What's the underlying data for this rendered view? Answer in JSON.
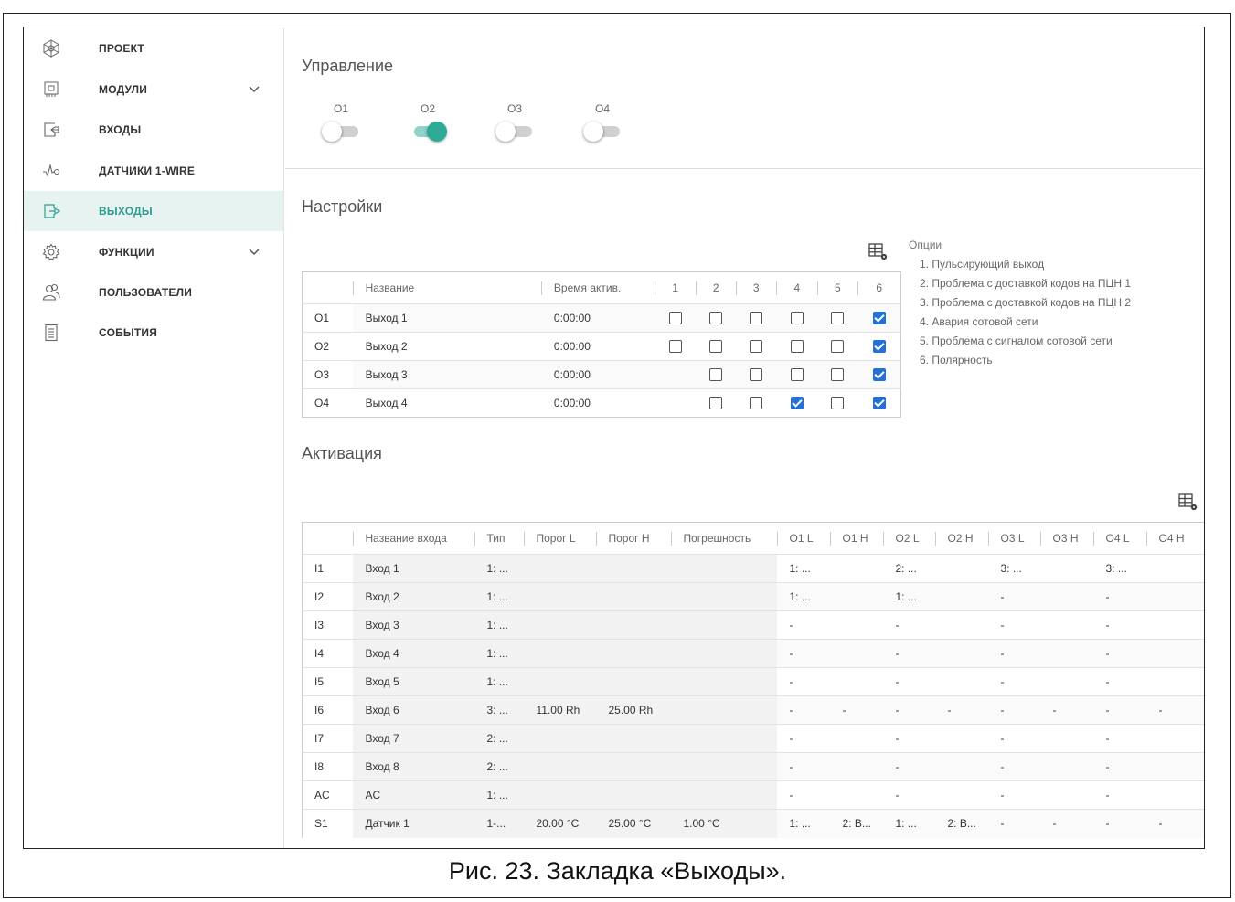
{
  "sidebar": {
    "items": [
      {
        "label": "ПРОЕКТ",
        "icon": "project-icon",
        "chevron": false,
        "active": false
      },
      {
        "label": "МОДУЛИ",
        "icon": "module-chip-icon",
        "chevron": true,
        "active": false
      },
      {
        "label": "ВХОДЫ",
        "icon": "input-arrow-icon",
        "chevron": false,
        "active": false
      },
      {
        "label": "ДАТЧИКИ 1-WIRE",
        "icon": "sensor-wave-icon",
        "chevron": false,
        "active": false
      },
      {
        "label": "ВЫХОДЫ",
        "icon": "output-arrow-icon",
        "chevron": false,
        "active": true
      },
      {
        "label": "ФУНКЦИИ",
        "icon": "gear-icon",
        "chevron": true,
        "active": false
      },
      {
        "label": "ПОЛЬЗОВАТЕЛИ",
        "icon": "users-icon",
        "chevron": false,
        "active": false
      },
      {
        "label": "СОБЫТИЯ",
        "icon": "events-list-icon",
        "chevron": false,
        "active": false
      }
    ]
  },
  "control": {
    "title": "Управление",
    "switches": [
      {
        "label": "O1",
        "on": false
      },
      {
        "label": "O2",
        "on": true
      },
      {
        "label": "O3",
        "on": false
      },
      {
        "label": "O4",
        "on": false
      }
    ]
  },
  "settings": {
    "title": "Настройки",
    "columns": [
      "Название",
      "Время актив.",
      "1",
      "2",
      "3",
      "4",
      "5",
      "6"
    ],
    "rows": [
      {
        "id": "O1",
        "name": "Выход 1",
        "time": "0:00:00",
        "opts": [
          false,
          false,
          false,
          false,
          false,
          true
        ]
      },
      {
        "id": "O2",
        "name": "Выход 2",
        "time": "0:00:00",
        "opts": [
          false,
          false,
          false,
          false,
          false,
          true
        ]
      },
      {
        "id": "O3",
        "name": "Выход 3",
        "time": "0:00:00",
        "opts": [
          null,
          false,
          false,
          false,
          false,
          true
        ]
      },
      {
        "id": "O4",
        "name": "Выход 4",
        "time": "0:00:00",
        "opts": [
          null,
          false,
          false,
          true,
          false,
          true
        ]
      }
    ],
    "options_title": "Опции",
    "options": [
      "1. Пульсирующий выход",
      "2. Проблема с доставкой кодов на ПЦН 1",
      "3. Проблема с доставкой кодов на ПЦН 2",
      "4. Авария сотовой сети",
      "5. Проблема с сигналом сотовой сети",
      "6. Полярность"
    ]
  },
  "activation": {
    "title": "Активация",
    "columns": [
      "Название входа",
      "Тип",
      "Порог L",
      "Порог H",
      "Погрешность",
      "O1 L",
      "O1 H",
      "O2 L",
      "O2 H",
      "O3 L",
      "O3 H",
      "O4 L",
      "O4 H"
    ],
    "rows": [
      [
        "I1",
        "Вход 1",
        "1: ...",
        "",
        "",
        "",
        "1: ...",
        "",
        "2: ...",
        "",
        "3: ...",
        "",
        "3: ...",
        ""
      ],
      [
        "I2",
        "Вход 2",
        "1: ...",
        "",
        "",
        "",
        "1: ...",
        "",
        "1: ...",
        "",
        "-",
        "",
        "-",
        ""
      ],
      [
        "I3",
        "Вход 3",
        "1: ...",
        "",
        "",
        "",
        "-",
        "",
        "-",
        "",
        "-",
        "",
        "-",
        ""
      ],
      [
        "I4",
        "Вход 4",
        "1: ...",
        "",
        "",
        "",
        "-",
        "",
        "-",
        "",
        "-",
        "",
        "-",
        ""
      ],
      [
        "I5",
        "Вход 5",
        "1: ...",
        "",
        "",
        "",
        "-",
        "",
        "-",
        "",
        "-",
        "",
        "-",
        ""
      ],
      [
        "I6",
        "Вход 6",
        "3: ...",
        "11.00 Rh",
        "25.00 Rh",
        "",
        "-",
        "-",
        "-",
        "-",
        "-",
        "-",
        "-",
        "-"
      ],
      [
        "I7",
        "Вход 7",
        "2: ...",
        "",
        "",
        "",
        "-",
        "",
        "-",
        "",
        "-",
        "",
        "-",
        ""
      ],
      [
        "I8",
        "Вход 8",
        "2: ...",
        "",
        "",
        "",
        "-",
        "",
        "-",
        "",
        "-",
        "",
        "-",
        ""
      ],
      [
        "AC",
        "AC",
        "1: ...",
        "",
        "",
        "",
        "-",
        "",
        "-",
        "",
        "-",
        "",
        "-",
        ""
      ],
      [
        "S1",
        "Датчик 1",
        "1-...",
        "20.00 °C",
        "25.00 °C",
        "1.00 °C",
        "1: ...",
        "2: B...",
        "1: ...",
        "2: B...",
        "-",
        "-",
        "-",
        "-"
      ]
    ]
  },
  "caption": "Рис. 23. Закладка «Выходы».",
  "colors": {
    "accent": "#2ea996",
    "active_bg": "#e6f3f1",
    "checkbox": "#2270d8"
  }
}
